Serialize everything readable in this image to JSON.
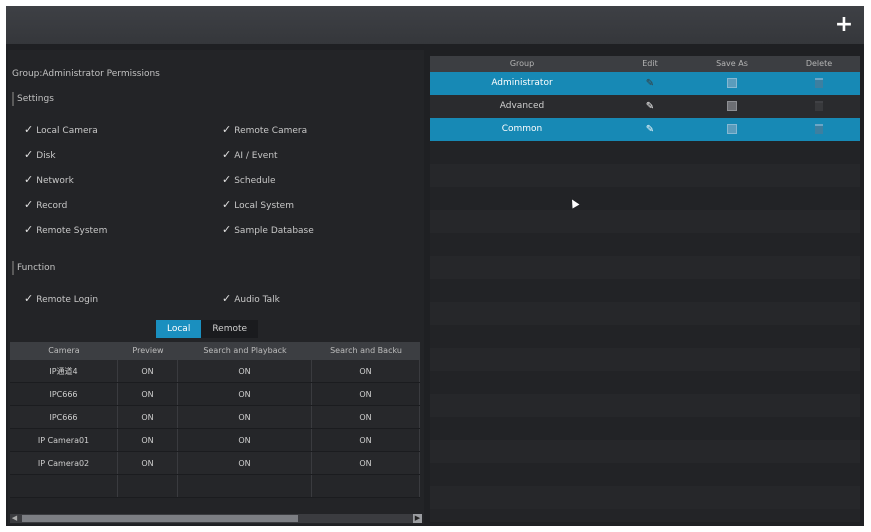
{
  "toolbar": {
    "add_icon": "plus-icon",
    "add_label": "+"
  },
  "left": {
    "title": "Group:Administrator Permissions",
    "settings": {
      "heading": "Settings",
      "items": [
        {
          "label": "Local Camera",
          "checked": true
        },
        {
          "label": "Remote Camera",
          "checked": true
        },
        {
          "label": "Disk",
          "checked": true
        },
        {
          "label": "AI / Event",
          "checked": true
        },
        {
          "label": "Network",
          "checked": true
        },
        {
          "label": "Schedule",
          "checked": true
        },
        {
          "label": "Record",
          "checked": true
        },
        {
          "label": "Local System",
          "checked": true
        },
        {
          "label": "Remote System",
          "checked": true
        },
        {
          "label": "Sample Database",
          "checked": true
        }
      ]
    },
    "function": {
      "heading": "Function",
      "items": [
        {
          "label": "Remote Login",
          "checked": true
        },
        {
          "label": "Audio Talk",
          "checked": true
        }
      ]
    },
    "tabs": {
      "local": "Local",
      "remote": "Remote",
      "active": "local"
    },
    "check_glyph": "✓",
    "camera_table": {
      "columns": [
        "Camera",
        "Preview",
        "Search and Playback",
        "Search and Backu"
      ],
      "rows": [
        [
          "IP通道4",
          "ON",
          "ON",
          "ON"
        ],
        [
          "IPC666",
          "ON",
          "ON",
          "ON"
        ],
        [
          "IPC666",
          "ON",
          "ON",
          "ON"
        ],
        [
          "IP Camera01",
          "ON",
          "ON",
          "ON"
        ],
        [
          "IP Camera02",
          "ON",
          "ON",
          "ON"
        ]
      ]
    },
    "scroll": {
      "left_arrow": "◀",
      "right_arrow": "▶"
    }
  },
  "right": {
    "group_table": {
      "columns": [
        "Group",
        "Edit",
        "Save As",
        "Delete"
      ],
      "rows": [
        {
          "name": "Administrator",
          "selected": true,
          "edit_enabled": false,
          "delete_enabled": true
        },
        {
          "name": "Advanced",
          "selected": false,
          "edit_enabled": true,
          "delete_enabled": false
        },
        {
          "name": "Common",
          "selected": true,
          "edit_enabled": true,
          "delete_enabled": true
        }
      ]
    },
    "edit_glyph": "✎"
  },
  "colors": {
    "accent": "#1789b5",
    "background": "#1f2023",
    "header": "#3c3e42"
  }
}
